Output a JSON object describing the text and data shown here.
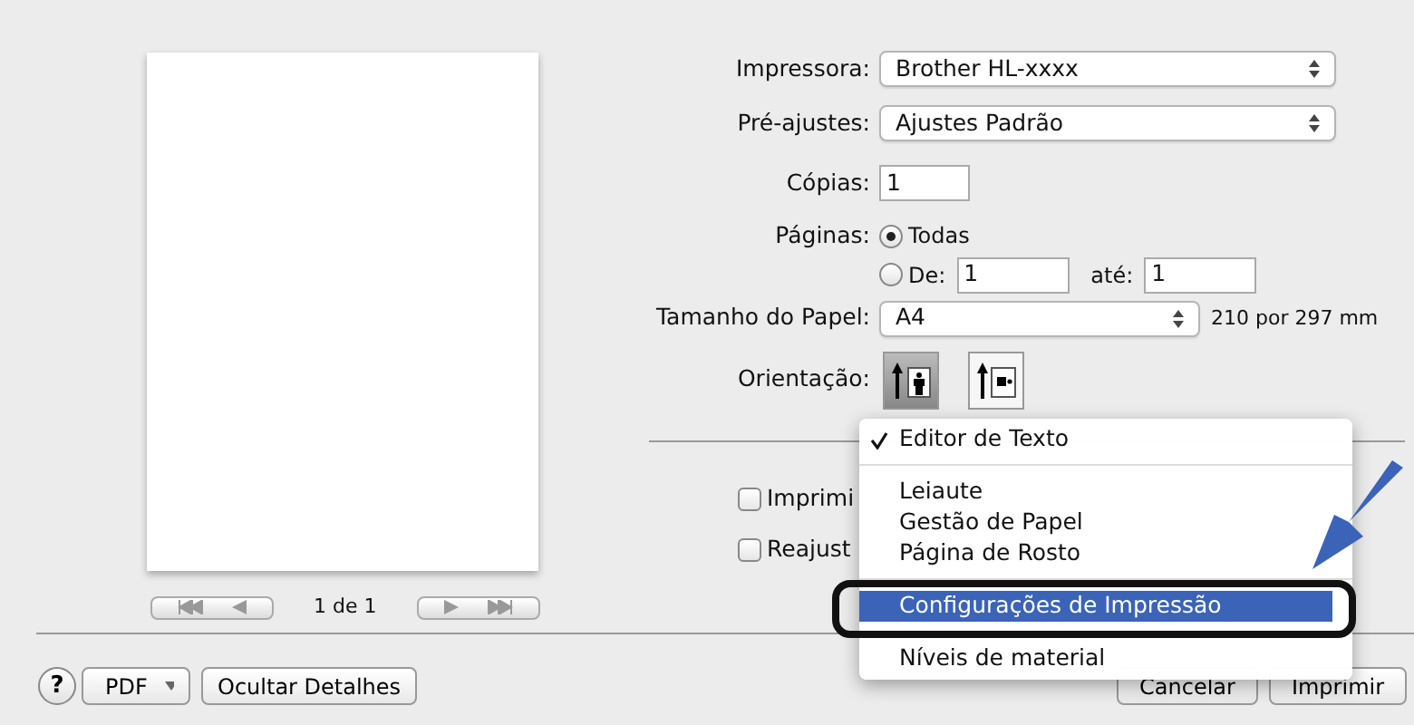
{
  "preview": {
    "page_label": "1 de 1"
  },
  "form": {
    "printer": {
      "label": "Impressora:",
      "value": "Brother HL-xxxx"
    },
    "presets": {
      "label": "Pré-ajustes:",
      "value": "Ajustes Padrão"
    },
    "copies": {
      "label": "Cópias:",
      "value": "1"
    },
    "pages": {
      "label": "Páginas:",
      "options": [
        {
          "label": "Todas",
          "selected": true
        },
        {
          "label": "De:",
          "selected": false,
          "from": "1",
          "to_label": "até:",
          "to": "1"
        }
      ]
    },
    "paper_size": {
      "label": "Tamanho do Papel:",
      "value": "A4",
      "dimensions": "210 por 297 mm"
    },
    "orientation": {
      "label": "Orientação:",
      "options": [
        {
          "kind": "portrait",
          "selected": true
        },
        {
          "kind": "landscape",
          "selected": false
        }
      ]
    }
  },
  "checkboxes": [
    {
      "label": "Imprimi",
      "checked": false
    },
    {
      "label": "Reajust",
      "checked": false
    }
  ],
  "menu": {
    "items": [
      {
        "kind": "item",
        "label": "Editor de Texto",
        "checked": true,
        "selected": false
      },
      {
        "kind": "separator"
      },
      {
        "kind": "item",
        "label": "Leiaute",
        "checked": false,
        "selected": false
      },
      {
        "kind": "item",
        "label": "Gestão de Papel",
        "checked": false,
        "selected": false
      },
      {
        "kind": "item",
        "label": "Página de Rosto",
        "checked": false,
        "selected": false
      },
      {
        "kind": "separator"
      },
      {
        "kind": "item",
        "label": "Configurações de Impressão",
        "checked": false,
        "selected": true
      },
      {
        "kind": "separator"
      },
      {
        "kind": "item",
        "label": "Níveis de material",
        "checked": false,
        "selected": false
      }
    ]
  },
  "bottom": {
    "help": "?",
    "pdf": "PDF",
    "toggle": "Ocultar Detalhes",
    "cancel": "Cancelar",
    "print": "Imprimir"
  }
}
